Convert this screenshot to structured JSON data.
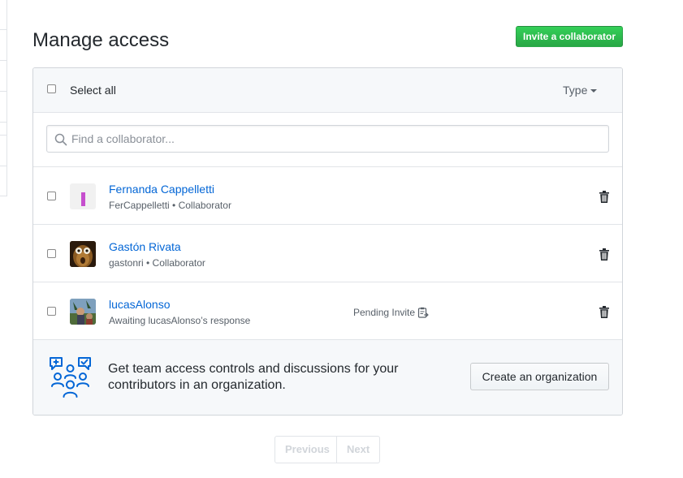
{
  "page": {
    "title": "Manage access",
    "invite_button": "Invite a collaborator"
  },
  "list_header": {
    "select_all_label": "Select all",
    "type_filter": "Type"
  },
  "search": {
    "placeholder": "Find a collaborator..."
  },
  "collaborators": [
    {
      "name": "Fernanda Cappelletti",
      "meta": "FerCappelletti • Collaborator",
      "status": ""
    },
    {
      "name": "Gastón Rivata",
      "meta": "gastonri • Collaborator",
      "status": ""
    },
    {
      "name": "lucasAlonso",
      "meta": "Awaiting lucasAlonso’s response",
      "status": "Pending Invite"
    }
  ],
  "promo": {
    "text": "Get team access controls and discussions for your contributors in an organization.",
    "button": "Create an organization"
  },
  "pagination": {
    "previous": "Previous",
    "next": "Next"
  },
  "colors": {
    "primary_button": "#28a745",
    "link": "#0366d6",
    "promo_icon": "#0366d6"
  }
}
